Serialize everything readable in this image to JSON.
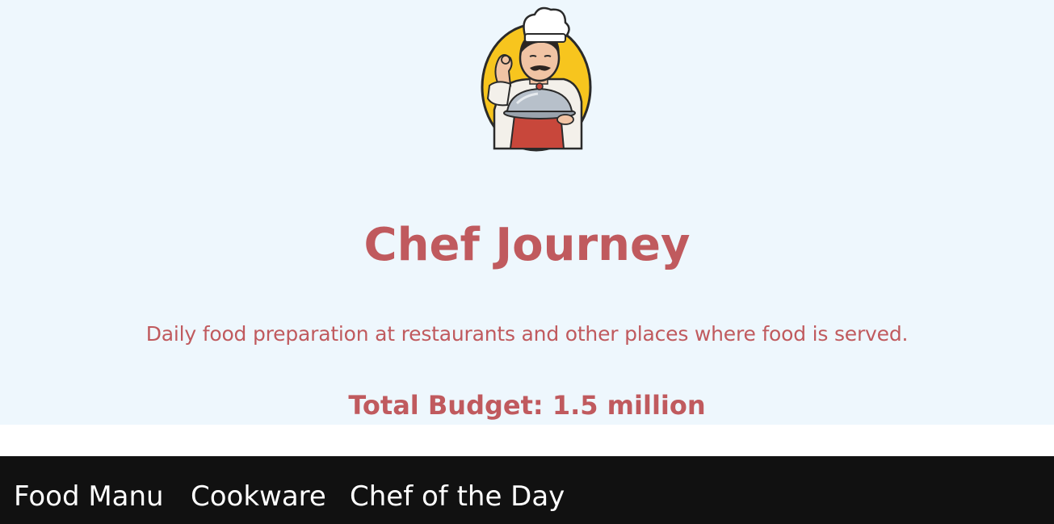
{
  "hero": {
    "logo_icon": "chef-mascot-icon",
    "title": "Chef Journey",
    "description": "Daily food preparation at restaurants and other places where food is served.",
    "budget": "Total Budget: 1.5 million"
  },
  "nav": {
    "items": [
      {
        "label": "Food Manu"
      },
      {
        "label": "Cookware"
      },
      {
        "label": "Chef of the Day"
      }
    ]
  },
  "colors": {
    "hero_background": "#eef7fd",
    "accent": "#c05a5e",
    "navbar_background": "#111111",
    "nav_text": "#ffffff"
  }
}
